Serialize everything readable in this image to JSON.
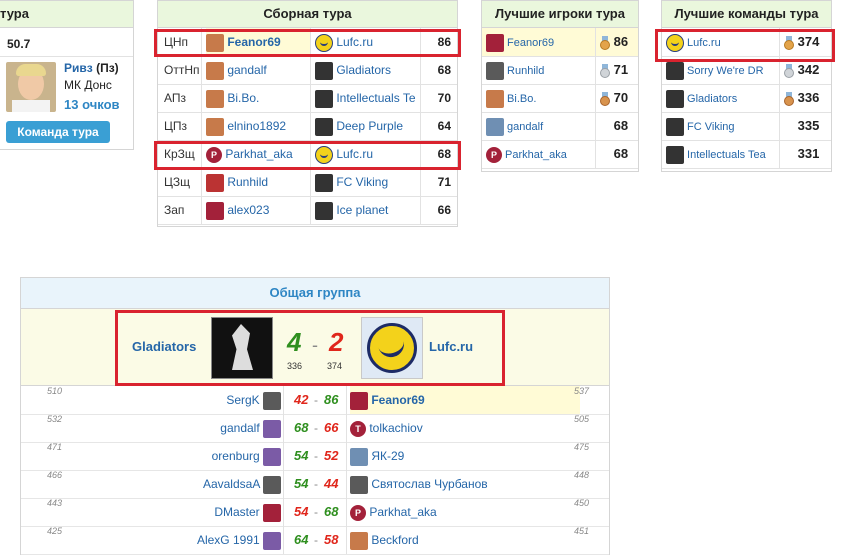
{
  "player_panel": {
    "header": "тура",
    "points_value": "50.7",
    "player_name": "Ривз",
    "player_pos": "(Пз)",
    "player_team": "МК Донс",
    "player_score": "13 очков",
    "button_label": "Команда тура"
  },
  "team_of_round": {
    "title": "Сборная тура",
    "rows": [
      {
        "pos": "ЦНп",
        "player": "Feanor69",
        "team": "Lufc.ru",
        "score": "86"
      },
      {
        "pos": "ОттНп",
        "player": "gandalf",
        "team": "Gladiators",
        "score": "68"
      },
      {
        "pos": "АПз",
        "player": "Bi.Bo.",
        "team": "Intellectuals Te",
        "score": "70"
      },
      {
        "pos": "ЦПз",
        "player": "elnino1892",
        "team": "Deep Purple",
        "score": "64"
      },
      {
        "pos": "КрЗщ",
        "player": "Parkhat_aka",
        "team": "Lufc.ru",
        "score": "68"
      },
      {
        "pos": "ЦЗщ",
        "player": "Runhild",
        "team": "FC Viking",
        "score": "71"
      },
      {
        "pos": "Зап",
        "player": "alex023",
        "team": "Ice planet",
        "score": "66"
      }
    ]
  },
  "best_players": {
    "title": "Лучшие игроки тура",
    "rows": [
      {
        "name": "Feanor69",
        "score": "86",
        "medal": "gold"
      },
      {
        "name": "Runhild",
        "score": "71",
        "medal": "silver"
      },
      {
        "name": "Bi.Bo.",
        "score": "70",
        "medal": "bronze"
      },
      {
        "name": "gandalf",
        "score": "68",
        "medal": ""
      },
      {
        "name": "Parkhat_aka",
        "score": "68",
        "medal": ""
      }
    ]
  },
  "best_teams": {
    "title": "Лучшие команды тура",
    "rows": [
      {
        "name": "Lufc.ru",
        "score": "374",
        "medal": "gold"
      },
      {
        "name": "Sorry We're DR",
        "score": "342",
        "medal": "silver"
      },
      {
        "name": "Gladiators",
        "score": "336",
        "medal": "bronze"
      },
      {
        "name": "FC Viking",
        "score": "335",
        "medal": ""
      },
      {
        "name": "Intellectuals Tea",
        "score": "331",
        "medal": ""
      }
    ]
  },
  "group": {
    "title": "Общая группа",
    "home_team": "Gladiators",
    "away_team": "Lufc.ru",
    "home_goals": "4",
    "separator": "-",
    "away_goals": "2",
    "home_total": "336",
    "away_total": "374",
    "matches": [
      {
        "hn": "510",
        "home": "SergK",
        "hs": "42",
        "as": "86",
        "away": "Feanor69",
        "an": "537",
        "away_bold": true
      },
      {
        "hn": "532",
        "home": "gandalf",
        "hs": "68",
        "as": "66",
        "away": "tolkachiov",
        "an": "505",
        "away_bold": false
      },
      {
        "hn": "471",
        "home": "orenburg",
        "hs": "54",
        "as": "52",
        "away": "ЯК-29",
        "an": "475",
        "away_bold": false
      },
      {
        "hn": "466",
        "home": "AavaldsaA",
        "hs": "54",
        "as": "44",
        "away": "Святослав Чурбанов",
        "an": "448",
        "away_bold": false
      },
      {
        "hn": "443",
        "home": "DMaster",
        "hs": "54",
        "as": "68",
        "away": "Parkhat_aka",
        "an": "450",
        "away_bold": false
      },
      {
        "hn": "425",
        "home": "AlexG 1991",
        "hs": "64",
        "as": "58",
        "away": "Beckford",
        "an": "451",
        "away_bold": false
      }
    ]
  },
  "colors": {
    "header_bg": "#eaf7dd",
    "highlight": "#d9232f",
    "win": "#2f8f1f",
    "loss": "#e0261b",
    "link": "#2566a8"
  }
}
